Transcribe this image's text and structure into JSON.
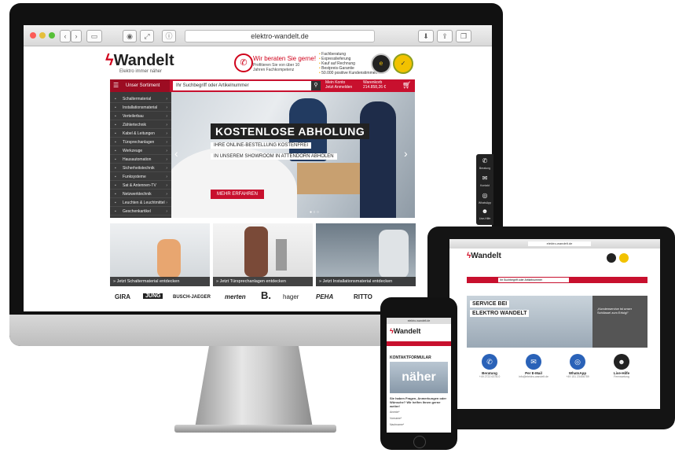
{
  "browser": {
    "url": "elektro-wandelt.de"
  },
  "site": {
    "logo": "Wandelt",
    "tagline": "Elektro immer näher",
    "hotline_title": "Wir beraten Sie gerne!",
    "hotline_sub": "Profitieren Sie von über 10 Jahren Fachkompetenz",
    "features": [
      "Fachberatung",
      "Expresslieferung",
      "Kauf auf Rechnung",
      "Bestpreis-Garantie",
      "50.000 positive Kundenstimmen"
    ],
    "nav_category": "Unser Sortiment",
    "search_placeholder": "Ihr Suchbegriff oder Artikelnummer",
    "account_label": "Mein Konto",
    "account_sub": "Jetzt Anmelden",
    "cart_label": "Warenkorb",
    "cart_value": "214.858,26 €"
  },
  "sidebar": {
    "items": [
      "Schaltermaterial",
      "Installationsmaterial",
      "Verteilerbau",
      "Zählertechnik",
      "Kabel & Leitungen",
      "Türsprechanlagen",
      "Werkzeuge",
      "Hausautomation",
      "Sicherheitstechnik",
      "Funksysteme",
      "Sat & Antennen-TV",
      "Netzwerktechnik",
      "Leuchten & Leuchtmittel",
      "Geschenkartikel"
    ]
  },
  "hero": {
    "title": "KOSTENLOSE ABHOLUNG",
    "sub1": "IHRE ONLINE-BESTELLUNG KOSTENFREI",
    "sub2": "IN UNSEREM SHOWROOM IN ATTENDORN ABHOLEN",
    "button": "MEHR ERFAHREN"
  },
  "tiles": [
    "» Jetzt Schaltermaterial entdecken",
    "» Jetzt Türsprechanlagen entdecken",
    "» Jetzt Installationsmaterial entdecken"
  ],
  "brands": [
    "GIRA",
    "JUNG",
    "BUSCH-JAEGER",
    "merten",
    "B.",
    "hager",
    "PEHA",
    "RITTO"
  ],
  "floatbar": [
    "Beratung",
    "Kontakt",
    "WhatsApp",
    "Live-Hilfe"
  ],
  "ipad": {
    "url": "elektro-wandelt.de",
    "logo": "Wandelt",
    "search_placeholder": "Ihr Suchbegriff oder Artikelnummer",
    "hero_title_1": "SERVICE BEI",
    "hero_title_2": "ELEKTRO WANDELT",
    "quote": "„Kundenservice ist unser Schlüssel zum Erfolg!“",
    "services": [
      {
        "label": "Beratung",
        "sub": "+49 2722 6378-0"
      },
      {
        "label": "Per E-Mail",
        "sub": "info@elektro-wandelt.de"
      },
      {
        "label": "WhatsApp",
        "sub": "+49 151 23456789"
      },
      {
        "label": "Live-Hilfe",
        "sub": "Fernwartung"
      }
    ]
  },
  "iphone": {
    "url": "elektro-wandelt.de",
    "logo": "Wandelt",
    "title": "KONTAKTFORMULAR",
    "image_text": "näher",
    "text": "Sie haben Fragen, Anmerkungen oder Wünsche? Wir helfen Ihnen gerne weiter!",
    "fields": [
      "Anrede*",
      "Vorname*",
      "Nachname*"
    ]
  },
  "colors": {
    "brand_red": "#c8102e",
    "dark": "#3a3a3a"
  }
}
